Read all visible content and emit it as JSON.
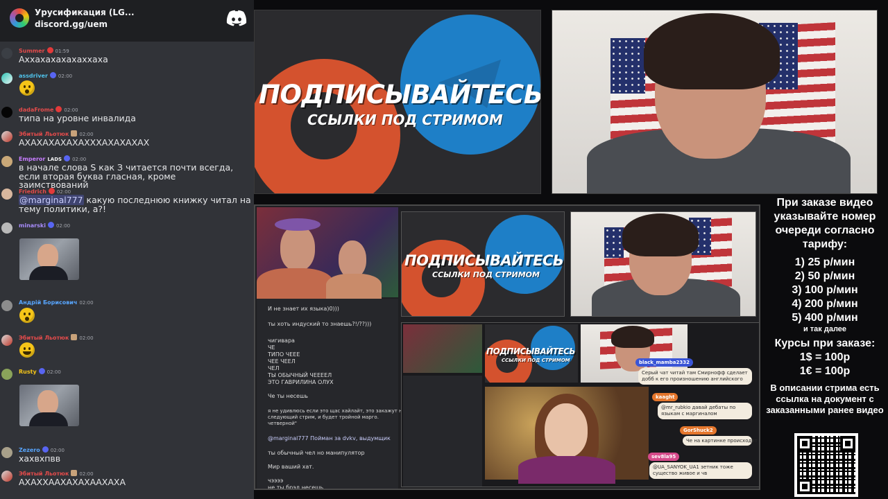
{
  "header": {
    "server_name": "Урусификация (LG...",
    "invite": "discord.gg/uem"
  },
  "chat": {
    "messages": [
      {
        "user": "Summer",
        "user_color": "#e34b4b",
        "time": "01:59",
        "text": "Аххахахахахаххаха"
      },
      {
        "user": "assdriver",
        "user_color": "#4fc1e9",
        "time": "02:00",
        "emoji": "astonished-face"
      },
      {
        "user": "dadaFrome",
        "user_color": "#e34b4b",
        "time": "02:00",
        "text": "типа на уровне инвалида"
      },
      {
        "user": "Эбитый Льотюк",
        "user_color": "#e34b4b",
        "time": "02:00",
        "text": "АХАХАХАХАХАХХХАХАХАХАХ"
      },
      {
        "user": "Emperor",
        "user_color": "#c77dff",
        "tag": "LADS",
        "time": "02:00",
        "text": "в начале слова S как З читается почти всегда, если вторая буква гласная, кроме заимствований"
      },
      {
        "user": "Friedrich",
        "user_color": "#e34b4b",
        "time": "02:00",
        "mention": "@marginal777",
        "text": " какую последнюю книжку читал на тему политики, а?!"
      },
      {
        "user": "minarski",
        "user_color": "#a78bfa",
        "time": "02:00",
        "image": "person-photo"
      },
      {
        "user": "Андрій Борисович",
        "user_color": "#58a6ff",
        "time": "02:00",
        "emoji": "astonished-face"
      },
      {
        "user": "Эбитый Льотюк",
        "user_color": "#e34b4b",
        "time": "02:00",
        "emoji": "laughing-crying-face"
      },
      {
        "user": "Rusty",
        "user_color": "#f5c518",
        "time": "02:00",
        "image": "person-photo"
      },
      {
        "user": "Zezero",
        "user_color": "#58a6ff",
        "time": "02:00",
        "text": "хахвхпвв"
      },
      {
        "user": "Эбитый Льотюк",
        "user_color": "#e34b4b",
        "time": "02:00",
        "text": "АХАХХААХАХАХААХАХА"
      }
    ]
  },
  "promo": {
    "title": "ПОДПИСЫВАЙТЕСЬ",
    "subtitle": "ССЫЛКИ ПОД СТРИМОМ"
  },
  "info": {
    "heading": "При заказе видео указывайте номер очереди согласно тарифу:",
    "tariffs": [
      "1) 25 р/мин",
      "2) 50 р/мин",
      "3) 100 р/мин",
      "4) 200 р/мин",
      "5) 400 р/мин"
    ],
    "etc": "и так далее",
    "rates_heading": "Курсы при заказе:",
    "rates": [
      "1$ = 100р",
      "1€ = 100р"
    ],
    "description": "В описании стрима есть ссылка на документ с заказанными ранее видео"
  },
  "nested": {
    "chat_lines": [
      {
        "user": "",
        "text": "И не знает их языка)0)))"
      },
      {
        "user": "",
        "text": "ты хоть индуский то знаешь?!/??)))"
      },
      {
        "user": "",
        "text": "чигивара"
      },
      {
        "user": "",
        "text": "ЧЕ"
      },
      {
        "user": "",
        "text": "ТИПО ЧЕЕЕ"
      },
      {
        "user": "",
        "text": "ЧЕЕ ЧЕЕЛ"
      },
      {
        "user": "",
        "text": "ЧЕЛ"
      },
      {
        "user": "",
        "text": "ТЫ ОБЫЧНЫЙ ЧЕЕЕЕЛ"
      },
      {
        "user": "",
        "text": "ЭТО ГАВРИЛИНА ОЛУХ"
      },
      {
        "user": "",
        "text": "Че ты несешь"
      },
      {
        "user": "",
        "text": "я не удивлюсь если это щас хайлайт, это закажут на"
      },
      {
        "user": "",
        "text": "следующий стрим, и будет тройной марго."
      },
      {
        "user": "",
        "text": "четверной\""
      },
      {
        "user": "",
        "text": "@marginal777 Пойман за dvkv, выдумщик"
      },
      {
        "user": "",
        "text": "ты обычный чел но манипулятор"
      },
      {
        "user": "",
        "text": "Мир ваший хат."
      },
      {
        "user": "",
        "text": "чээээ"
      },
      {
        "user": "",
        "text": "не ты брэд несешь"
      }
    ],
    "bubbles": [
      {
        "name": "black_mamba2332",
        "name_color": "#3a55d6",
        "text": "Серый чат читай там Смирнофф сделает добб к его произношению английского"
      },
      {
        "name": "kaaght",
        "name_color": "#e4762c",
        "text": "@mr_rubkio давай дебаты по языкам с маргиналом"
      },
      {
        "name": "GorShuck2",
        "name_color": "#e4762c",
        "text": "Че на картинке происходит"
      },
      {
        "name": "sev8la95",
        "name_color": "#d64a8a",
        "text": "@UA_SANYOK_UA1 зетник тоже существо живое и чв"
      }
    ]
  }
}
